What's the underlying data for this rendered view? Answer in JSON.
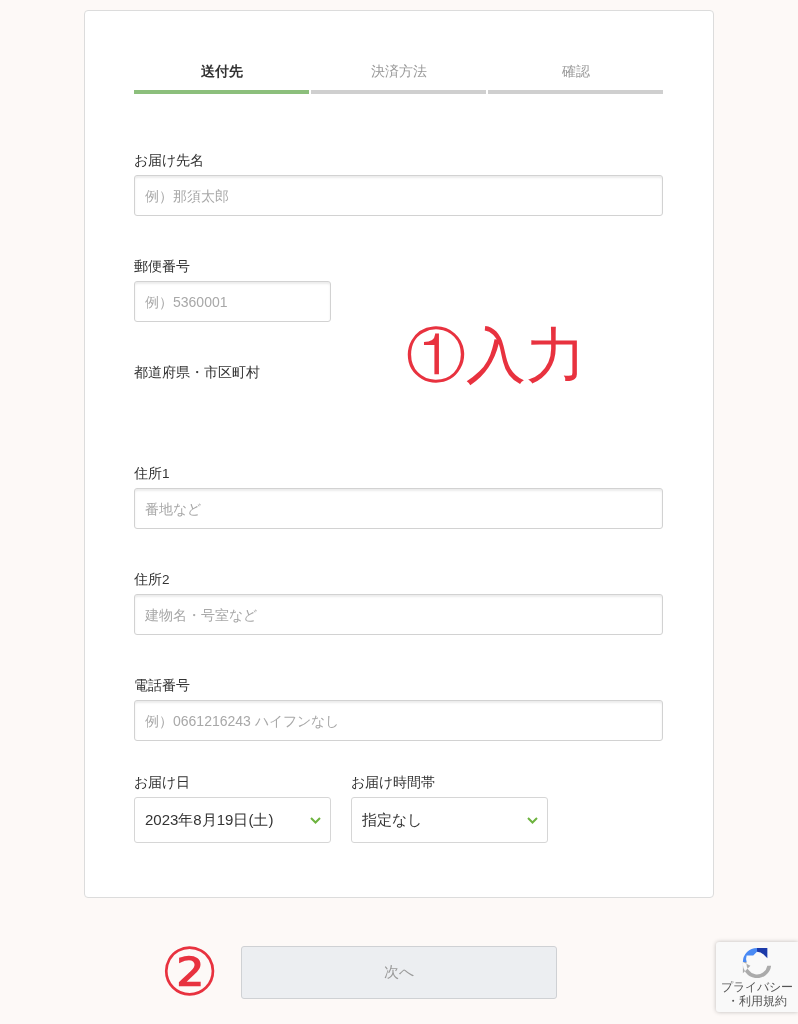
{
  "steps": [
    {
      "label": "送付先",
      "selected": true
    },
    {
      "label": "決済方法",
      "selected": false
    },
    {
      "label": "確認",
      "selected": false
    }
  ],
  "fields": [
    {
      "kind": "wide",
      "label": "お届け先名",
      "placeholder": "例）那須太郎"
    },
    {
      "kind": "narrow",
      "label": "郵便番号",
      "placeholder": "例）5360001"
    },
    {
      "kind": "label",
      "label": "都道府県・市区町村"
    },
    {
      "kind": "wide",
      "label": "住所1",
      "placeholder": "番地など"
    },
    {
      "kind": "wide",
      "label": "住所2",
      "placeholder": "建物名・号室など"
    },
    {
      "kind": "wide",
      "label": "電話番号",
      "placeholder": "例）0661216243 ハイフンなし"
    }
  ],
  "selects": [
    {
      "label": "お届け日",
      "value": "2023年8月19日(土)"
    },
    {
      "label": "お届け時間帯",
      "value": "指定なし"
    }
  ],
  "annotations": {
    "input": "①入力",
    "next": "②"
  },
  "next_button": {
    "label": "次へ",
    "disabled": true
  },
  "privacy_badge": {
    "text": "プライバシー・利用規約"
  }
}
